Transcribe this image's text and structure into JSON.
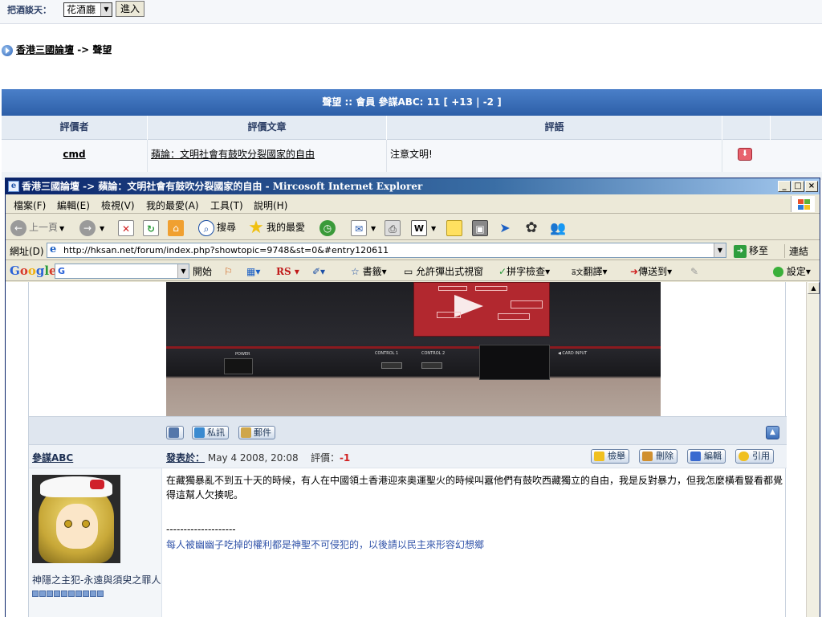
{
  "chat": {
    "label": "把酒談天：",
    "selected": "花酒廳",
    "enter_label": "進入"
  },
  "breadcrumb": {
    "forum": "香港三國論壇",
    "separator": " -> ",
    "current": "聲望"
  },
  "reputation": {
    "header": "聲望 :: 會員 參謀ABC: 11 [ +13 | -2 ]",
    "columns": [
      "評價者",
      "評價文章",
      "評語"
    ],
    "rows": [
      {
        "rater": "cmd",
        "article": "蘋論：文明社會有鼓吹分裂國家的自由",
        "comment": "注意文明!"
      }
    ]
  },
  "window": {
    "title": "香港三國論壇 -> 蘋論：文明社會有鼓吹分裂國家的自由 - Mircosoft Internet Explorer",
    "caption_buttons": [
      "_",
      "□",
      "×"
    ],
    "menus": [
      "檔案(F)",
      "編輯(E)",
      "檢視(V)",
      "我的最愛(A)",
      "工具(T)",
      "說明(H)"
    ],
    "toolbar": {
      "back": "上一頁",
      "search": "搜尋",
      "favorites": "我的最愛"
    },
    "address": {
      "label": "網址(D)",
      "url": "http://hksan.net/forum/index.php?showtopic=9748&st=0&#entry120611",
      "go": "移至",
      "links": "連結"
    },
    "googlebar": {
      "logo": "Google",
      "search_prefix": "G",
      "start": "開始",
      "rs": "RS",
      "bookmarks": "書籤",
      "popup": "允許彈出式視窗",
      "spell": "拼字檢查",
      "translate": "翻譯",
      "send": "傳送到",
      "settings": "設定"
    }
  },
  "post_footer": {
    "pm": "私訊",
    "email": "郵件"
  },
  "post": {
    "author": "參謀ABC",
    "posted_label": "發表於：",
    "date": "May 4 2008, 20:08",
    "rating_label": "評價：",
    "rating": "-1",
    "actions": [
      "檢舉",
      "刪除",
      "編輯",
      "引用"
    ],
    "body": "在藏獨暴亂不到五十天的時候，有人在中國領土香港迎來奧運聖火的時候叫囂他們有鼓吹西藏獨立的自由，我是反對暴力，但我怎麼橫看豎看都覺得這幫人欠揍呢。",
    "sig_divider": "--------------------",
    "signature": "每人被幽幽子吃掉的權利都是神聖不可侵犯的，以後請以民主來形容幻想鄉",
    "member_title": "神隱之主犯-永遠與須臾之罪人"
  },
  "colors": {
    "title_bar": "#0a246a",
    "header_blue": "#2d5fa8",
    "negative": "#d02020",
    "signature": "#3355aa"
  }
}
